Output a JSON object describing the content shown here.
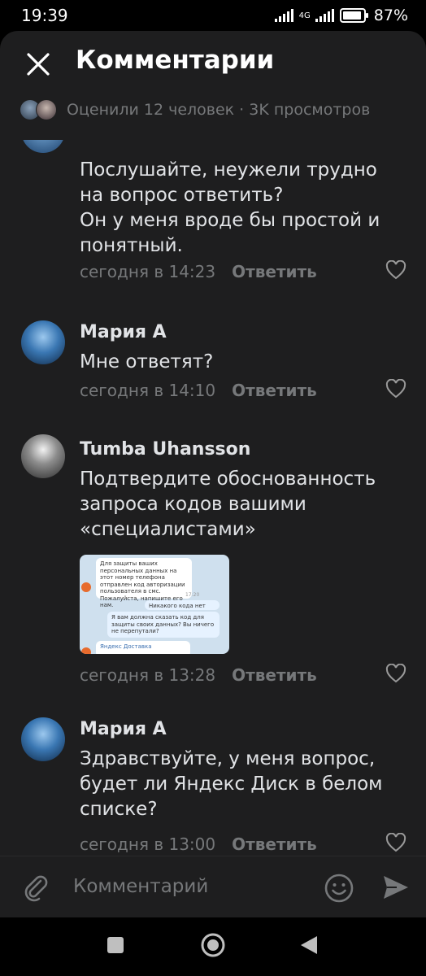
{
  "status_bar": {
    "time": "19:39",
    "network": "4G",
    "battery": "87%"
  },
  "header": {
    "title": "Комментарии",
    "meta": "Оценили 12 человек · 3K просмотров"
  },
  "comments": [
    {
      "author": "",
      "text": "Послушайте, неужели трудно на вопрос ответить?\nОн у меня вроде бы простой и понятный.",
      "time": "сегодня в 14:23",
      "reply": "Ответить"
    },
    {
      "author": "Мария А",
      "text": "Мне ответят?",
      "time": "сегодня в 14:10",
      "reply": "Ответить"
    },
    {
      "author": "Tumba Uhansson",
      "text": "Подтвердите обоснованность запроса кодов вашими «специалистами»",
      "time": "сегодня в 13:28",
      "reply": "Ответить",
      "attachment": {
        "msg1": "Для защиты ваших персональных данных на этот номер телефона отправлен код авторизации пользователя в смс. Пожалуйста, напишите его нам.",
        "msg1_time": "17:20",
        "msg2": "Никакого кода нет",
        "msg2_time": "17:20",
        "msg3": "Я вам должна сказать код для защиты своих данных? Вы ничего не перепутали?",
        "msg3_time": "17:20",
        "msg4_sender": "Яндекс Доставка"
      }
    },
    {
      "author": "Мария А",
      "text": "Здравствуйте, у меня вопрос, будет ли Яндекс Диск в белом списке?",
      "time": "сегодня в 13:00",
      "reply": "Ответить"
    }
  ],
  "input": {
    "placeholder": "Комментарий"
  },
  "colors": {
    "background": "#1e1e1f",
    "text": "#e1e3e6",
    "secondary": "#76787a"
  }
}
